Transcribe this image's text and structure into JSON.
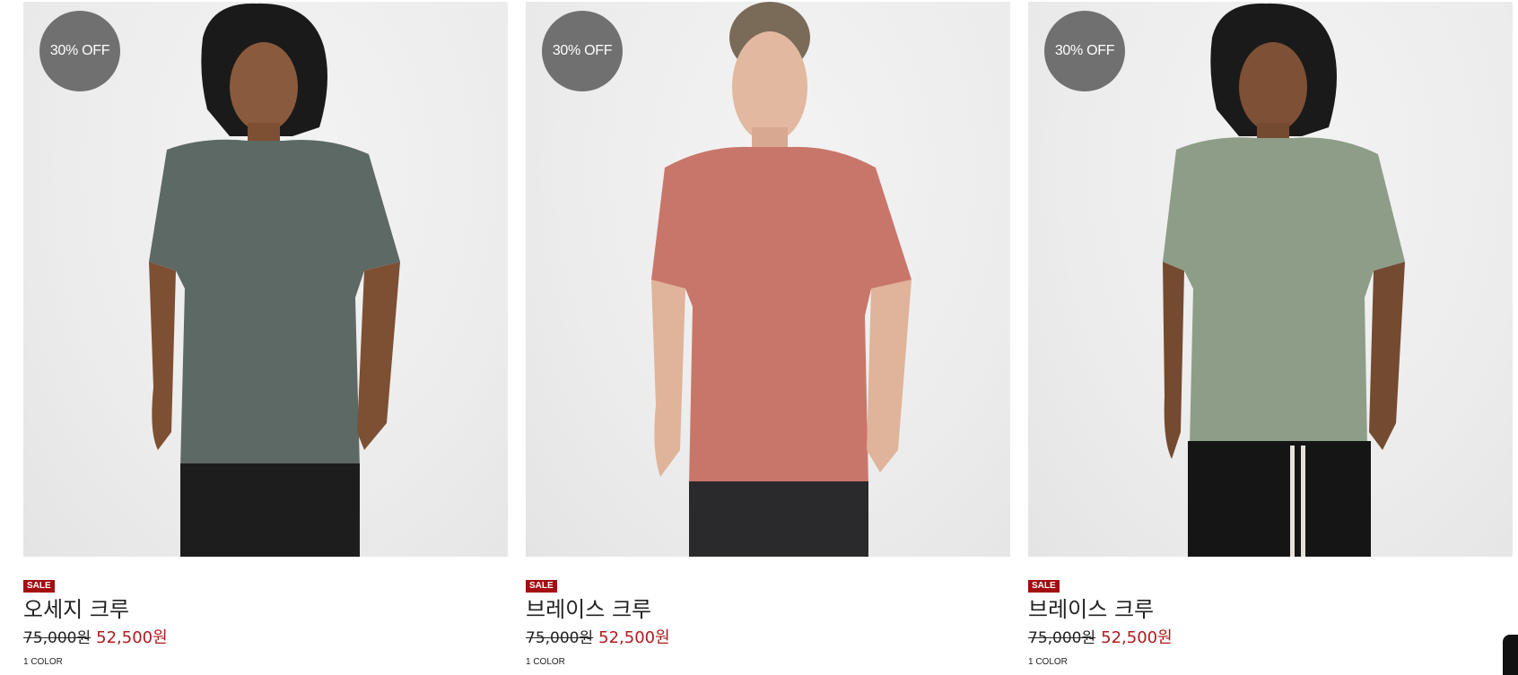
{
  "products": [
    {
      "badge": "30% OFF",
      "sale_tag": "SALE",
      "name": "오세지 크루",
      "price_original": "75,000원",
      "price_sale": "52,500원",
      "colors": "1 COLOR",
      "shirt_color": "#5d6964",
      "pants_color": "#1d1d1d"
    },
    {
      "badge": "30% OFF",
      "sale_tag": "SALE",
      "name": "브레이스 크루",
      "price_original": "75,000원",
      "price_sale": "52,500원",
      "colors": "1 COLOR",
      "shirt_color": "#c9766a",
      "pants_color": "#2a2a2c"
    },
    {
      "badge": "30% OFF",
      "sale_tag": "SALE",
      "name": "브레이스 크루",
      "price_original": "75,000원",
      "price_sale": "52,500원",
      "colors": "1 COLOR",
      "shirt_color": "#8e9d88",
      "pants_color": "#151515"
    }
  ],
  "colors": {
    "sale_tag_bg": "#a30d12",
    "sale_price": "#b0191d",
    "badge_bg": "#707070"
  }
}
